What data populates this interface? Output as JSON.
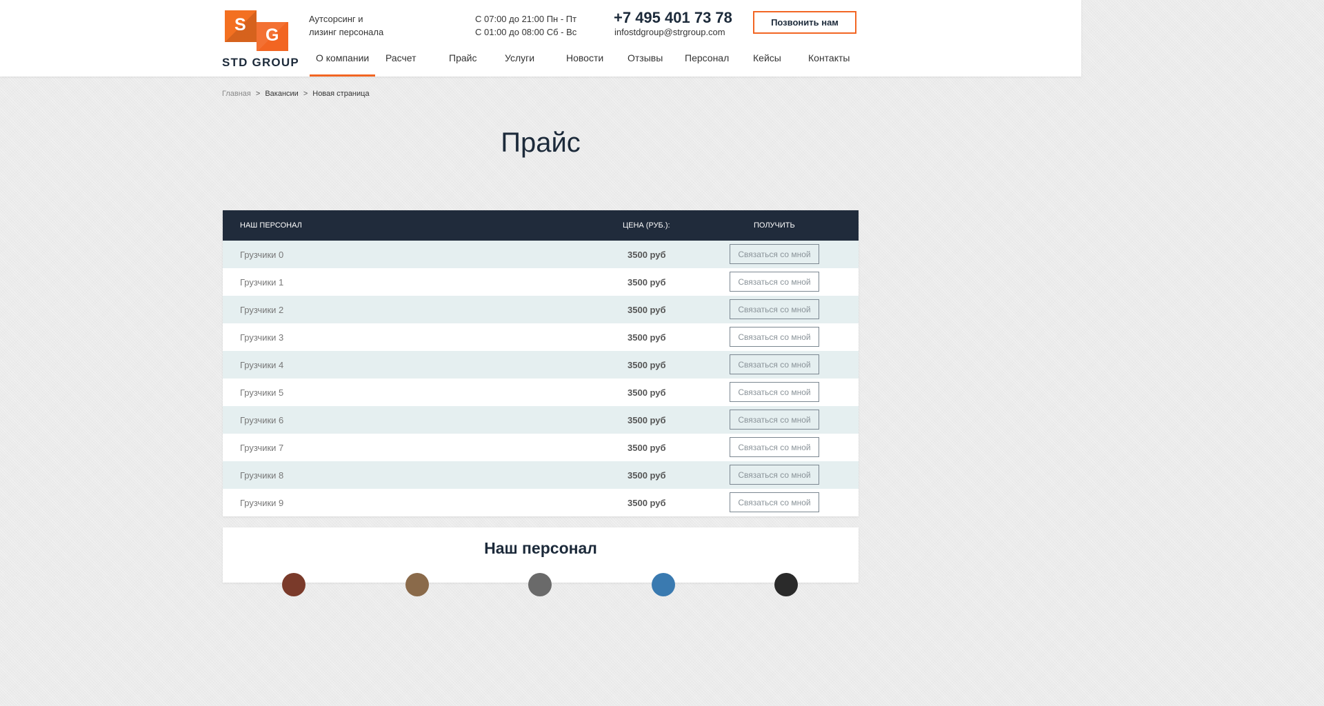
{
  "header": {
    "logo": {
      "s": "S",
      "g": "G",
      "name": "STD GROUP"
    },
    "tagline": [
      "Аутсорсинг и",
      "лизинг персонала"
    ],
    "hours": [
      "С 07:00 до 21:00 Пн - Пт",
      "С 01:00 до 08:00 Сб - Вс"
    ],
    "phone": "+7 495 401 73 78",
    "email": "infostdgroup@strgroup.com",
    "call_button": "Позвонить нам"
  },
  "nav": [
    "О компании",
    "Расчет",
    "Прайс",
    "Услуги",
    "Новости",
    "Отзывы",
    "Персонал",
    "Кейсы",
    "Контакты"
  ],
  "nav_active": "О компании",
  "breadcrumb": [
    "Главная",
    "Вакансии",
    "Новая страница"
  ],
  "breadcrumb_separator": ">",
  "page_title": "Прайс",
  "price_table": {
    "columns": [
      "НАШ ПЕРСОНАЛ",
      "ЦЕНА (РУБ.):",
      "ПОЛУЧИТЬ"
    ],
    "rows": [
      {
        "name": "Грузчики 0",
        "price": "3500 руб",
        "button": "Связаться со мной"
      },
      {
        "name": "Грузчики 1",
        "price": "3500 руб",
        "button": "Связаться со мной"
      },
      {
        "name": "Грузчики 2",
        "price": "3500 руб",
        "button": "Связаться со мной"
      },
      {
        "name": "Грузчики 3",
        "price": "3500 руб",
        "button": "Связаться со мной"
      },
      {
        "name": "Грузчики 4",
        "price": "3500 руб",
        "button": "Связаться со мной"
      },
      {
        "name": "Грузчики 5",
        "price": "3500 руб",
        "button": "Связаться со мной"
      },
      {
        "name": "Грузчики 6",
        "price": "3500 руб",
        "button": "Связаться со мной"
      },
      {
        "name": "Грузчики 7",
        "price": "3500 руб",
        "button": "Связаться со мной"
      },
      {
        "name": "Грузчики 8",
        "price": "3500 руб",
        "button": "Связаться со мной"
      },
      {
        "name": "Грузчики 9",
        "price": "3500 руб",
        "button": "Связаться со мной"
      }
    ]
  },
  "staff_section": {
    "title": "Наш персонал"
  },
  "colors": {
    "accent": "#f26522",
    "table_header": "#202b3b",
    "row_alt": "#e5eff0",
    "title": "#1c2a3a"
  }
}
